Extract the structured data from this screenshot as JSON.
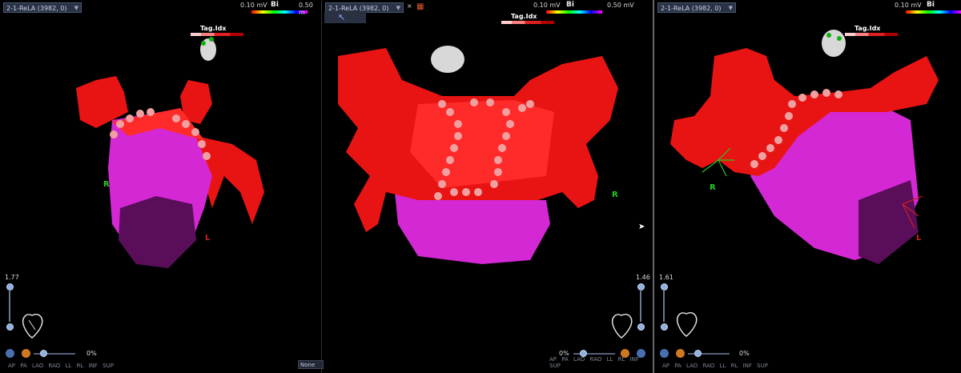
{
  "panes": [
    {
      "map_name": "2-1-ReLA (3982, 0)",
      "scale_min": "0.10 mV",
      "scale_max": "0.50 m",
      "scale_label": "Bi",
      "tag_label": "Tag.Idx",
      "zoom": "1.77",
      "transparency": "0%",
      "orient_r": "R",
      "orient_l": "L",
      "views": [
        "AP",
        "PA",
        "LAO",
        "RAO",
        "LL",
        "RL",
        "INF",
        "SUP"
      ]
    },
    {
      "map_name": "2-1-ReLA (3982, 0)",
      "close": "×",
      "scale_min": "0.10 mV",
      "scale_max": "0.50 mV",
      "scale_label": "Bi",
      "tag_label": "Tag.Idx",
      "zoom": "1.46",
      "transparency": "0%",
      "orient_r": "R",
      "views": [
        "AP",
        "PA",
        "LAO",
        "RAO",
        "LL",
        "RL",
        "INF",
        "SUP"
      ],
      "none_select": "None"
    },
    {
      "map_name": "2-1-ReLA (3982, 0)",
      "scale_min": "0.10 mV",
      "scale_label": "Bi",
      "tag_label": "Tag.Idx",
      "zoom": "1.61",
      "transparency": "0%",
      "orient_r": "R",
      "orient_l": "L",
      "views": [
        "AP",
        "PA",
        "LAO",
        "RAO",
        "LL",
        "RL",
        "INF",
        "SUP"
      ]
    }
  ],
  "colors": {
    "scar": "#e81414",
    "healthy": "#d428d4",
    "tag_ball": "#f0a0a0",
    "bg": "#000000"
  }
}
